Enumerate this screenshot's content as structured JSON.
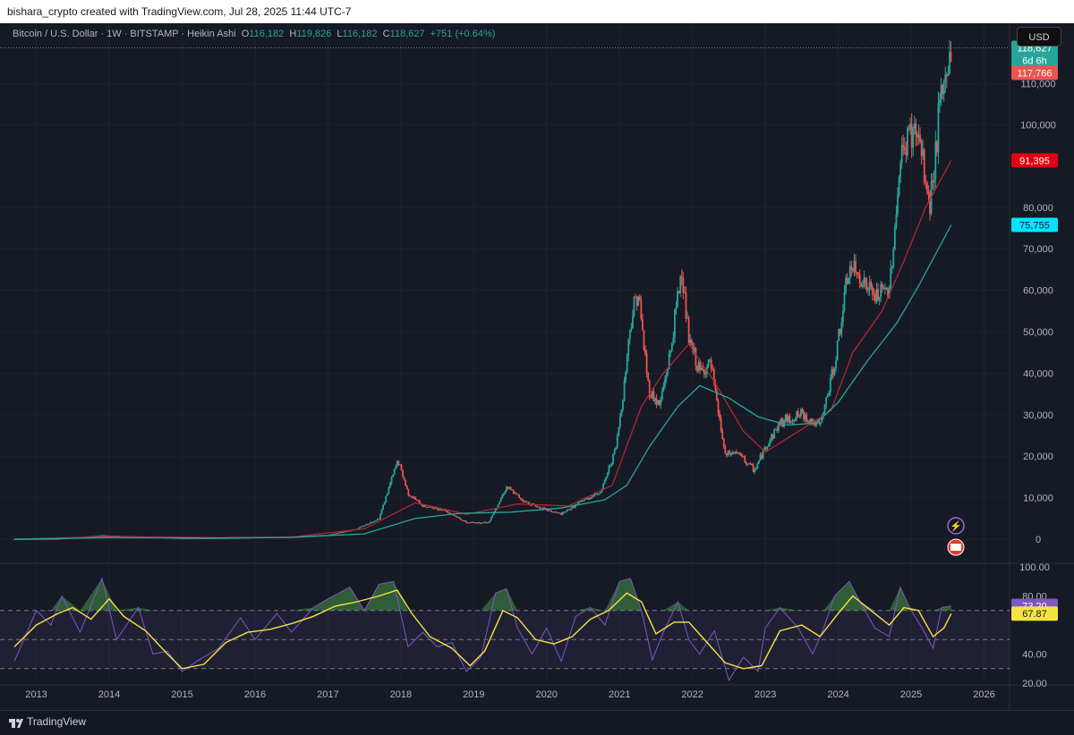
{
  "header": {
    "attribution": "bishara_crypto created with TradingView.com, Jul 28, 2025 11:44 UTC-7"
  },
  "legend": {
    "symbol": "Bitcoin / U.S. Dollar · 1W · BITSTAMP · Heikin Ashi",
    "o_label": "O",
    "o": "116,182",
    "h_label": "H",
    "h": "119,826",
    "l_label": "L",
    "l": "116,182",
    "c_label": "C",
    "c": "118,627",
    "change": "+751 (+0.64%)"
  },
  "currency_button": "USD",
  "footer": {
    "brand": "TradingView"
  },
  "colors": {
    "background": "#161a25",
    "up": "#26a69a",
    "down": "#ef5350",
    "ma_fast": "#b22833",
    "ma_slow": "#26a69a",
    "rsi": "#7e57c2",
    "rsi_ma": "#f5e342",
    "ma_slow_label": "#00e5ff"
  },
  "chart_data": [
    {
      "type": "candlestick",
      "title": "Bitcoin / U.S. Dollar · 1W · BITSTAMP · Heikin Ashi",
      "x_ticks": [
        "2013",
        "2014",
        "2015",
        "2016",
        "2017",
        "2018",
        "2019",
        "2020",
        "2021",
        "2022",
        "2023",
        "2024",
        "2025",
        "2026"
      ],
      "y_ticks": [
        "0",
        "10,000",
        "20,000",
        "30,000",
        "40,000",
        "50,000",
        "60,000",
        "70,000",
        "80,000",
        "100,000",
        "110,000"
      ],
      "ylim": [
        0,
        126000
      ],
      "xlim": [
        2012.6,
        2026.35
      ],
      "price_path": [
        [
          2012.7,
          12
        ],
        [
          2013.3,
          100
        ],
        [
          2013.9,
          900
        ],
        [
          2014.5,
          550
        ],
        [
          2015.0,
          250
        ],
        [
          2015.5,
          260
        ],
        [
          2016.0,
          420
        ],
        [
          2016.5,
          650
        ],
        [
          2017.0,
          1000
        ],
        [
          2017.4,
          2500
        ],
        [
          2017.7,
          5000
        ],
        [
          2017.96,
          19000
        ],
        [
          2018.1,
          11000
        ],
        [
          2018.3,
          8000
        ],
        [
          2018.6,
          7000
        ],
        [
          2018.9,
          4000
        ],
        [
          2019.2,
          4000
        ],
        [
          2019.45,
          12500
        ],
        [
          2019.7,
          9000
        ],
        [
          2019.95,
          7300
        ],
        [
          2020.2,
          6000
        ],
        [
          2020.5,
          9300
        ],
        [
          2020.75,
          11500
        ],
        [
          2020.95,
          22000
        ],
        [
          2021.05,
          35000
        ],
        [
          2021.15,
          52000
        ],
        [
          2021.25,
          60000
        ],
        [
          2021.4,
          36000
        ],
        [
          2021.55,
          32000
        ],
        [
          2021.7,
          45000
        ],
        [
          2021.85,
          65000
        ],
        [
          2021.95,
          48000
        ],
        [
          2022.1,
          40000
        ],
        [
          2022.25,
          42000
        ],
        [
          2022.45,
          20000
        ],
        [
          2022.6,
          21000
        ],
        [
          2022.85,
          16500
        ],
        [
          2023.0,
          22000
        ],
        [
          2023.2,
          28000
        ],
        [
          2023.5,
          30000
        ],
        [
          2023.75,
          27000
        ],
        [
          2023.95,
          42000
        ],
        [
          2024.15,
          65000
        ],
        [
          2024.3,
          63000
        ],
        [
          2024.5,
          58000
        ],
        [
          2024.7,
          60000
        ],
        [
          2024.85,
          90000
        ],
        [
          2024.97,
          98000
        ],
        [
          2025.1,
          97000
        ],
        [
          2025.25,
          80000
        ],
        [
          2025.4,
          104000
        ],
        [
          2025.55,
          118627
        ]
      ],
      "series": [
        {
          "name": "",
          "color": "#b22833",
          "last_value": "91,395",
          "points": [
            [
              2012.7,
              10
            ],
            [
              2014.0,
              600
            ],
            [
              2015.5,
              350
            ],
            [
              2016.5,
              520
            ],
            [
              2017.5,
              2500
            ],
            [
              2018.2,
              8800
            ],
            [
              2018.9,
              6000
            ],
            [
              2019.6,
              8500
            ],
            [
              2020.3,
              8000
            ],
            [
              2020.9,
              13000
            ],
            [
              2021.3,
              32000
            ],
            [
              2021.6,
              40000
            ],
            [
              2021.95,
              47000
            ],
            [
              2022.3,
              38000
            ],
            [
              2022.7,
              26000
            ],
            [
              2023.0,
              21000
            ],
            [
              2023.5,
              26500
            ],
            [
              2023.9,
              31000
            ],
            [
              2024.2,
              45000
            ],
            [
              2024.6,
              55000
            ],
            [
              2024.9,
              67000
            ],
            [
              2025.2,
              80000
            ],
            [
              2025.55,
              91395
            ]
          ]
        },
        {
          "name": "",
          "color": "#26a69a",
          "last_value": "75,755",
          "points": [
            [
              2012.7,
              8
            ],
            [
              2014.0,
              350
            ],
            [
              2015.5,
              300
            ],
            [
              2016.5,
              420
            ],
            [
              2017.5,
              1300
            ],
            [
              2018.2,
              5000
            ],
            [
              2018.8,
              6200
            ],
            [
              2019.5,
              6500
            ],
            [
              2020.2,
              7500
            ],
            [
              2020.8,
              9500
            ],
            [
              2021.1,
              13000
            ],
            [
              2021.4,
              22000
            ],
            [
              2021.8,
              32000
            ],
            [
              2022.1,
              37000
            ],
            [
              2022.5,
              34000
            ],
            [
              2022.9,
              29500
            ],
            [
              2023.3,
              27500
            ],
            [
              2023.7,
              28000
            ],
            [
              2024.0,
              33000
            ],
            [
              2024.4,
              43000
            ],
            [
              2024.8,
              52000
            ],
            [
              2025.1,
              61000
            ],
            [
              2025.55,
              75755
            ]
          ]
        }
      ],
      "price_labels": {
        "current": "118,627",
        "countdown": "6d 6h",
        "high_marker": "117,766"
      }
    },
    {
      "type": "line",
      "title": "",
      "y_ticks": [
        "100.00",
        "80.00",
        "40.00",
        "20.00"
      ],
      "ylim": [
        20,
        100
      ],
      "bands": [
        30,
        50,
        70
      ],
      "series": [
        {
          "name": "",
          "color": "#7e57c2",
          "last_value": "73.20",
          "points": [
            [
              2012.7,
              35
            ],
            [
              2013.0,
              70
            ],
            [
              2013.2,
              60
            ],
            [
              2013.35,
              80
            ],
            [
              2013.6,
              55
            ],
            [
              2013.9,
              92
            ],
            [
              2014.1,
              50
            ],
            [
              2014.4,
              72
            ],
            [
              2014.6,
              40
            ],
            [
              2014.8,
              42
            ],
            [
              2015.0,
              28
            ],
            [
              2015.2,
              35
            ],
            [
              2015.5,
              44
            ],
            [
              2015.8,
              65
            ],
            [
              2016.0,
              50
            ],
            [
              2016.3,
              68
            ],
            [
              2016.5,
              55
            ],
            [
              2016.8,
              72
            ],
            [
              2017.0,
              78
            ],
            [
              2017.3,
              86
            ],
            [
              2017.5,
              70
            ],
            [
              2017.7,
              88
            ],
            [
              2017.9,
              90
            ],
            [
              2018.1,
              45
            ],
            [
              2018.3,
              55
            ],
            [
              2018.5,
              45
            ],
            [
              2018.7,
              48
            ],
            [
              2018.9,
              28
            ],
            [
              2019.1,
              38
            ],
            [
              2019.3,
              82
            ],
            [
              2019.45,
              85
            ],
            [
              2019.6,
              58
            ],
            [
              2019.8,
              40
            ],
            [
              2020.0,
              58
            ],
            [
              2020.2,
              35
            ],
            [
              2020.4,
              66
            ],
            [
              2020.6,
              72
            ],
            [
              2020.8,
              60
            ],
            [
              2021.0,
              90
            ],
            [
              2021.15,
              92
            ],
            [
              2021.3,
              70
            ],
            [
              2021.45,
              36
            ],
            [
              2021.6,
              55
            ],
            [
              2021.8,
              76
            ],
            [
              2021.95,
              50
            ],
            [
              2022.1,
              40
            ],
            [
              2022.3,
              56
            ],
            [
              2022.5,
              22
            ],
            [
              2022.7,
              38
            ],
            [
              2022.9,
              28
            ],
            [
              2023.0,
              58
            ],
            [
              2023.2,
              72
            ],
            [
              2023.45,
              58
            ],
            [
              2023.65,
              40
            ],
            [
              2023.8,
              58
            ],
            [
              2023.95,
              80
            ],
            [
              2024.15,
              90
            ],
            [
              2024.3,
              76
            ],
            [
              2024.5,
              58
            ],
            [
              2024.7,
              52
            ],
            [
              2024.85,
              86
            ],
            [
              2025.0,
              70
            ],
            [
              2025.15,
              58
            ],
            [
              2025.3,
              44
            ],
            [
              2025.42,
              72
            ],
            [
              2025.55,
              73
            ]
          ]
        },
        {
          "name": "",
          "color": "#f5e342",
          "last_value": "67.87",
          "points": [
            [
              2012.7,
              45
            ],
            [
              2013.0,
              60
            ],
            [
              2013.3,
              68
            ],
            [
              2013.5,
              72
            ],
            [
              2013.75,
              64
            ],
            [
              2014.0,
              78
            ],
            [
              2014.2,
              66
            ],
            [
              2014.5,
              56
            ],
            [
              2014.8,
              40
            ],
            [
              2015.0,
              30
            ],
            [
              2015.3,
              33
            ],
            [
              2015.6,
              48
            ],
            [
              2015.9,
              55
            ],
            [
              2016.2,
              57
            ],
            [
              2016.5,
              61
            ],
            [
              2016.8,
              66
            ],
            [
              2017.1,
              73
            ],
            [
              2017.4,
              76
            ],
            [
              2017.7,
              80
            ],
            [
              2017.95,
              84
            ],
            [
              2018.15,
              68
            ],
            [
              2018.4,
              52
            ],
            [
              2018.7,
              44
            ],
            [
              2018.95,
              32
            ],
            [
              2019.15,
              42
            ],
            [
              2019.4,
              70
            ],
            [
              2019.6,
              65
            ],
            [
              2019.85,
              50
            ],
            [
              2020.1,
              47
            ],
            [
              2020.35,
              52
            ],
            [
              2020.6,
              64
            ],
            [
              2020.85,
              70
            ],
            [
              2021.1,
              82
            ],
            [
              2021.3,
              76
            ],
            [
              2021.5,
              54
            ],
            [
              2021.75,
              62
            ],
            [
              2021.95,
              62
            ],
            [
              2022.2,
              48
            ],
            [
              2022.45,
              34
            ],
            [
              2022.7,
              30
            ],
            [
              2022.95,
              32
            ],
            [
              2023.2,
              56
            ],
            [
              2023.5,
              60
            ],
            [
              2023.75,
              52
            ],
            [
              2024.0,
              68
            ],
            [
              2024.2,
              80
            ],
            [
              2024.45,
              70
            ],
            [
              2024.7,
              60
            ],
            [
              2024.9,
              72
            ],
            [
              2025.1,
              70
            ],
            [
              2025.3,
              52
            ],
            [
              2025.45,
              58
            ],
            [
              2025.55,
              67.87
            ]
          ]
        }
      ]
    }
  ]
}
